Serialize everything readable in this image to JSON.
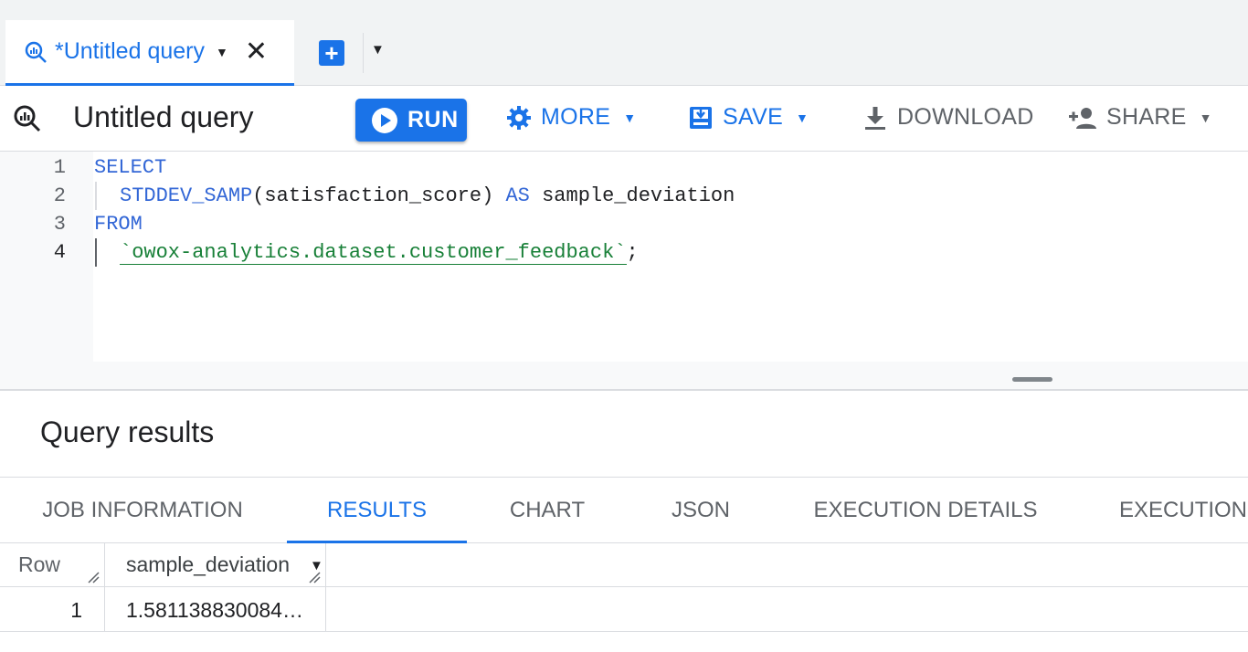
{
  "query_tab": {
    "label": "*Untitled query",
    "icon": "query-icon",
    "caret_icon": "caret-down-icon",
    "close_icon": "close-icon",
    "new_tab_icon": "add-box-icon",
    "more_icon": "caret-down-icon"
  },
  "toolbar": {
    "title": "Untitled query",
    "run_label": "RUN",
    "more_label": "MORE",
    "save_label": "SAVE",
    "download_label": "DOWNLOAD",
    "share_label": "SHARE"
  },
  "editor": {
    "lines": [
      {
        "number": "1",
        "text": "SELECT"
      },
      {
        "number": "2",
        "text": "STDDEV_SAMP(satisfaction_score) AS sample_deviation"
      },
      {
        "number": "3",
        "text": "FROM"
      },
      {
        "number": "4",
        "text": "`owox-analytics.dataset.customer_feedback`;"
      }
    ],
    "tokens": {
      "select": "SELECT",
      "fn": "STDDEV_SAMP",
      "args": "(satisfaction_score)",
      "as": "AS",
      "alias": "sample_deviation",
      "from": "FROM",
      "table": "`owox-analytics.dataset.customer_feedback`",
      "semicolon": ";"
    }
  },
  "results": {
    "title": "Query results",
    "tabs": [
      {
        "label": "JOB INFORMATION",
        "active": false
      },
      {
        "label": "RESULTS",
        "active": true
      },
      {
        "label": "CHART",
        "active": false
      },
      {
        "label": "JSON",
        "active": false
      },
      {
        "label": "EXECUTION DETAILS",
        "active": false
      },
      {
        "label": "EXECUTION",
        "active": false
      }
    ],
    "columns": [
      "Row",
      "sample_deviation"
    ],
    "rows": [
      {
        "row": "1",
        "sample_deviation": "1.581138830084…"
      }
    ]
  },
  "colors": {
    "accent": "#1a73e8",
    "keyword": "#3367d6",
    "string": "#188038"
  }
}
